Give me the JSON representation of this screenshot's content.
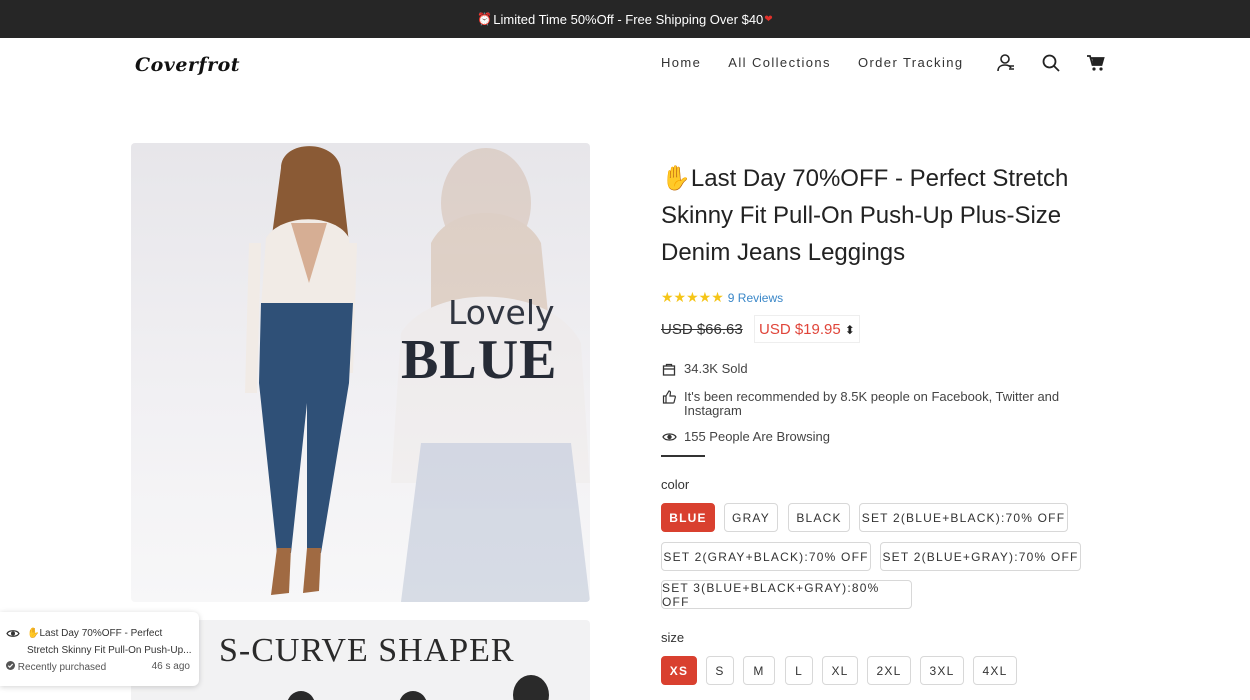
{
  "announcement": {
    "prefix_icon": "alarm-clock-icon",
    "text": "Limited Time 50%Off - Free Shipping Over $40",
    "suffix_icon": "heart-icon"
  },
  "header": {
    "logo": "Coverfrot",
    "nav": [
      "Home",
      "All Collections",
      "Order Tracking"
    ],
    "icons": [
      "user-icon",
      "search-icon",
      "cart-icon"
    ]
  },
  "gallery": {
    "main_image": {
      "text_small": "Lovely",
      "text_large": "BLUE"
    },
    "second_image": {
      "text": "S-CURVE  SHAPER"
    }
  },
  "product": {
    "title_emoji": "✋",
    "title": "Last Day 70%OFF - Perfect Stretch Skinny Fit Pull-On Push-Up Plus-Size Denim Jeans Leggings",
    "rating_stars": 5,
    "reviews": "9 Reviews",
    "price_old": "USD $66.63",
    "price_new": "USD $19.95",
    "sold": "34.3K Sold",
    "recommended": "It's been recommended by 8.5K people on Facebook, Twitter and Instagram",
    "browsing": "155 People Are Browsing",
    "color_label": "color",
    "colors": [
      "BLUE",
      "GRAY",
      "BLACK",
      "SET 2(BLUE+BLACK):70% OFF",
      "SET 2(GRAY+BLACK):70% OFF",
      "SET 2(BLUE+GRAY):70% OFF",
      "SET 3(BLUE+BLACK+GRAY):80% OFF"
    ],
    "selected_color": "BLUE",
    "size_label": "size",
    "sizes": [
      "XS",
      "S",
      "M",
      "L",
      "XL",
      "2XL",
      "3XL",
      "4XL"
    ],
    "selected_size": "XS"
  },
  "toast": {
    "text": "Last Day 70%OFF - Perfect Stretch Skinny Fit Pull-On Push-Up...",
    "status": "Recently purchased",
    "time": "46 s ago"
  },
  "colors": {
    "accent": "#d9402f",
    "price": "#e0453a",
    "topbar": "#262626",
    "link": "#3a87c8",
    "star": "#f5c518"
  }
}
